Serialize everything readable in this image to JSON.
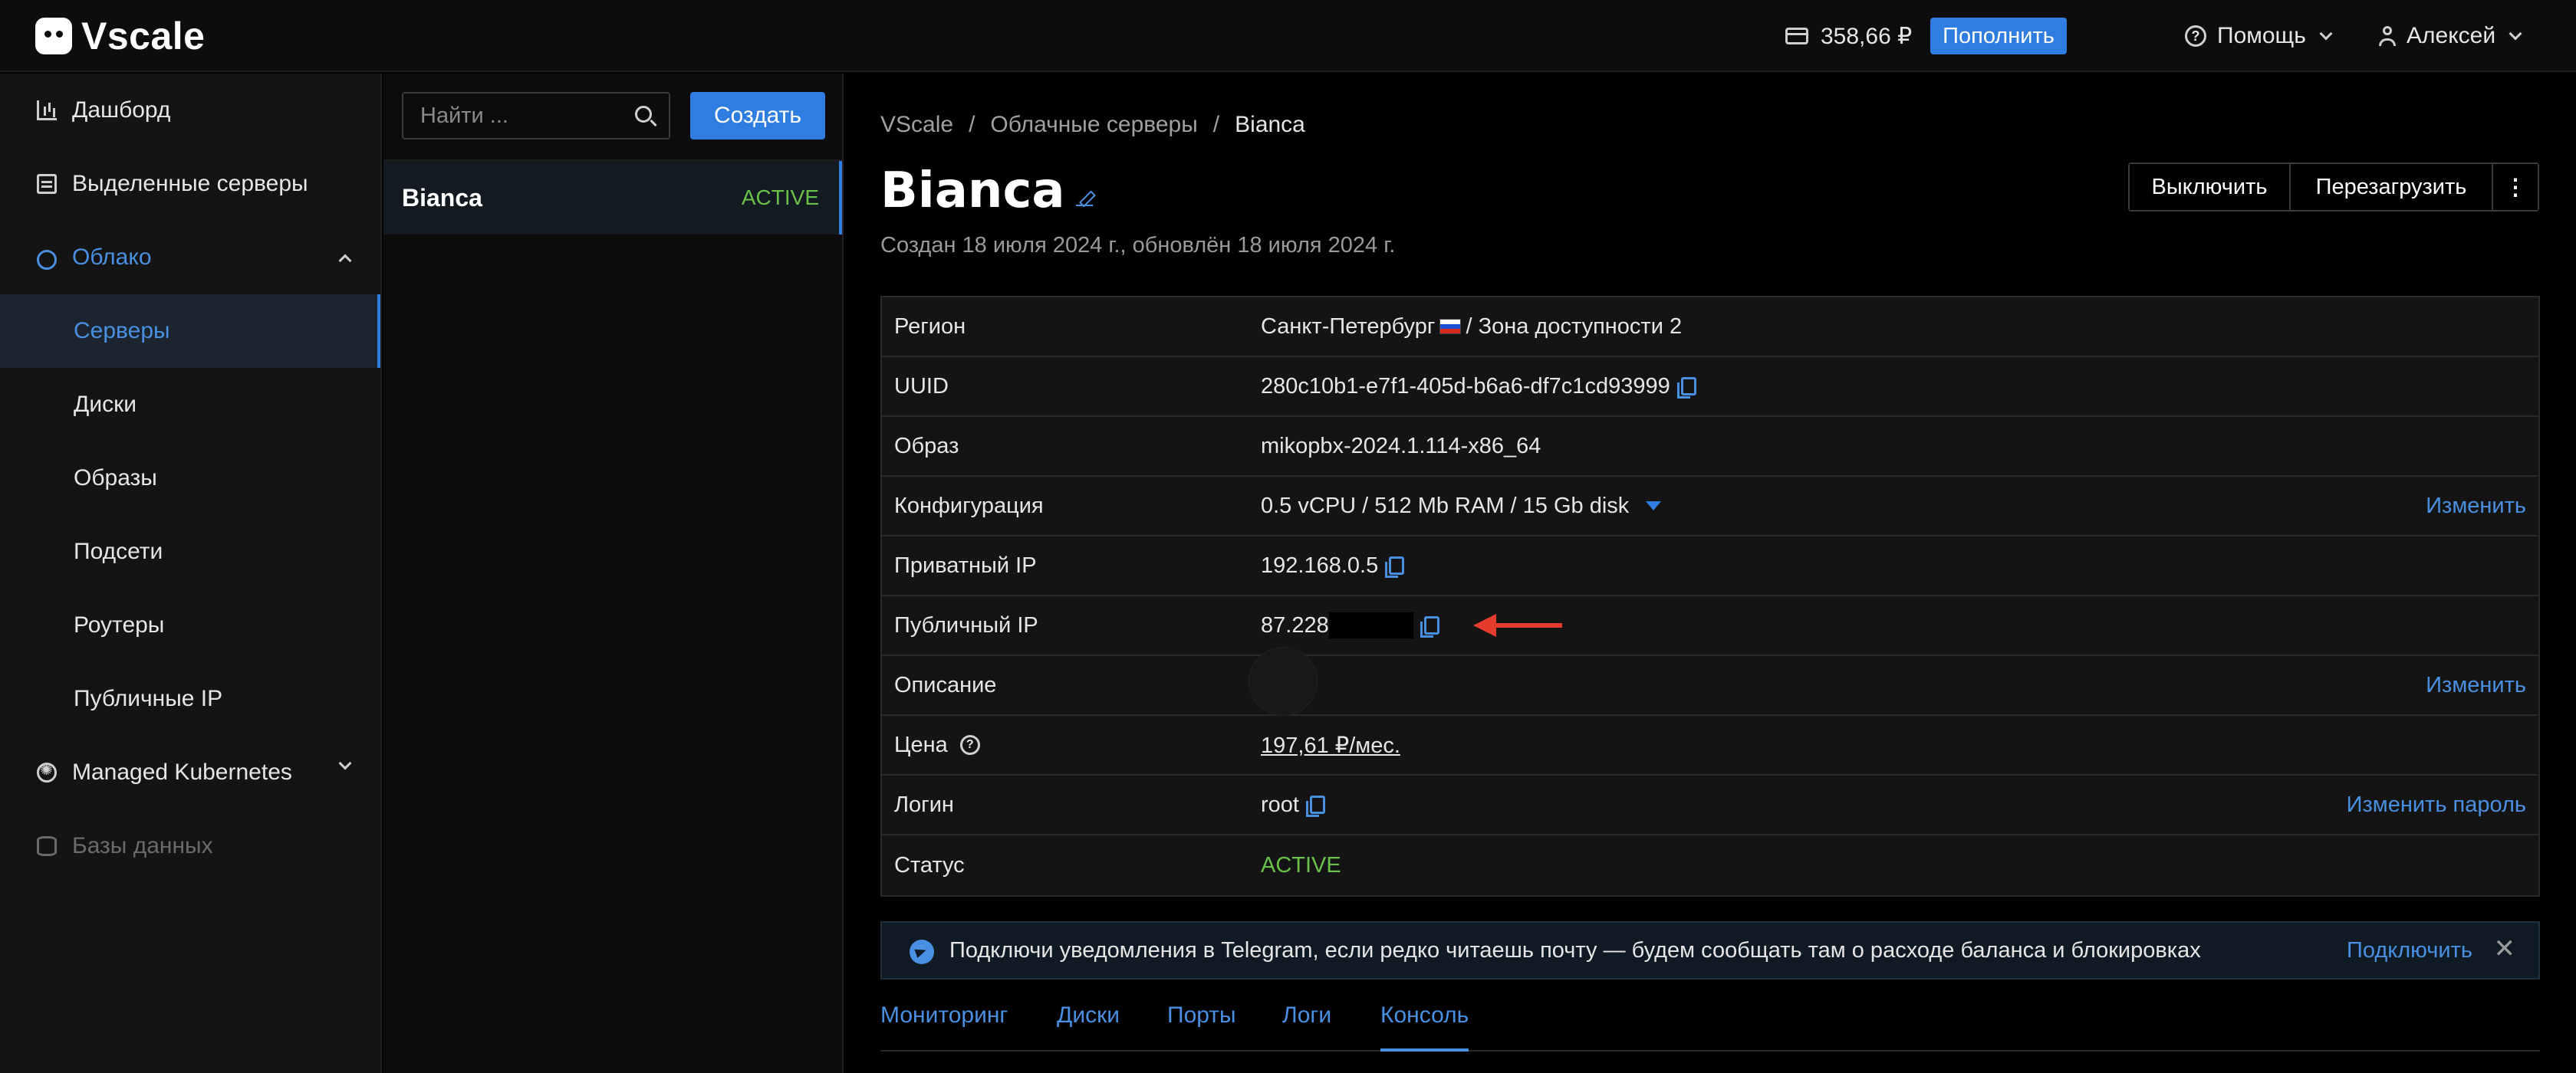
{
  "brand": {
    "name": "Vscale"
  },
  "topbar": {
    "balance": "358,66 ₽",
    "topup_label": "Пополнить",
    "help_label": "Помощь",
    "user_name": "Алексей"
  },
  "sidebar": {
    "items": [
      {
        "label": "Дашборд"
      },
      {
        "label": "Выделенные серверы"
      },
      {
        "label": "Облако"
      },
      {
        "label": "Серверы"
      },
      {
        "label": "Диски"
      },
      {
        "label": "Образы"
      },
      {
        "label": "Подсети"
      },
      {
        "label": "Роутеры"
      },
      {
        "label": "Публичные IP"
      },
      {
        "label": "Managed Kubernetes"
      },
      {
        "label": "Базы данных"
      }
    ]
  },
  "server_list": {
    "search_placeholder": "Найти ...",
    "create_label": "Создать",
    "items": [
      {
        "name": "Bianca",
        "status": "ACTIVE"
      }
    ]
  },
  "breadcrumb": {
    "root": "VScale",
    "section": "Облачные серверы",
    "current": "Bianca"
  },
  "server": {
    "title": "Bianca",
    "subtitle": "Создан 18 июля 2024 г., обновлён 18 июля 2024 г."
  },
  "actions": {
    "power_off": "Выключить",
    "reboot": "Перезагрузить",
    "more": "⋮"
  },
  "details": {
    "region_label": "Регион",
    "region_value": "Санкт-Петербург",
    "region_zone": "/ Зона доступности 2",
    "uuid_label": "UUID",
    "uuid_value": "280c10b1-e7f1-405d-b6a6-df7c1cd93999",
    "image_label": "Образ",
    "image_value": "mikopbx-2024.1.114-x86_64",
    "config_label": "Конфигурация",
    "config_value": "0.5 vCPU / 512 Mb RAM / 15 Gb disk",
    "config_action": "Изменить",
    "private_ip_label": "Приватный IP",
    "private_ip_value": "192.168.0.5",
    "public_ip_label": "Публичный IP",
    "public_ip_value": "87.228",
    "description_label": "Описание",
    "description_action": "Изменить",
    "price_label": "Цена",
    "price_value": "197,61 ₽/мес.",
    "login_label": "Логин",
    "login_value": "root",
    "login_action": "Изменить пароль",
    "status_label": "Статус",
    "status_value": "ACTIVE"
  },
  "telegram_banner": {
    "text": "Подключи уведомления в Telegram, если редко читаешь почту — будем сообщать там о расходе баланса и блокировках",
    "connect_label": "Подключить",
    "close_label": "✕"
  },
  "tabs": [
    {
      "label": "Мониторинг"
    },
    {
      "label": "Диски"
    },
    {
      "label": "Порты"
    },
    {
      "label": "Логи"
    },
    {
      "label": "Консоль"
    }
  ],
  "colors": {
    "accent": "#2f7de1",
    "link": "#4a90e2",
    "status_active": "#6ac14a",
    "annotation_arrow": "#e53b2c"
  }
}
